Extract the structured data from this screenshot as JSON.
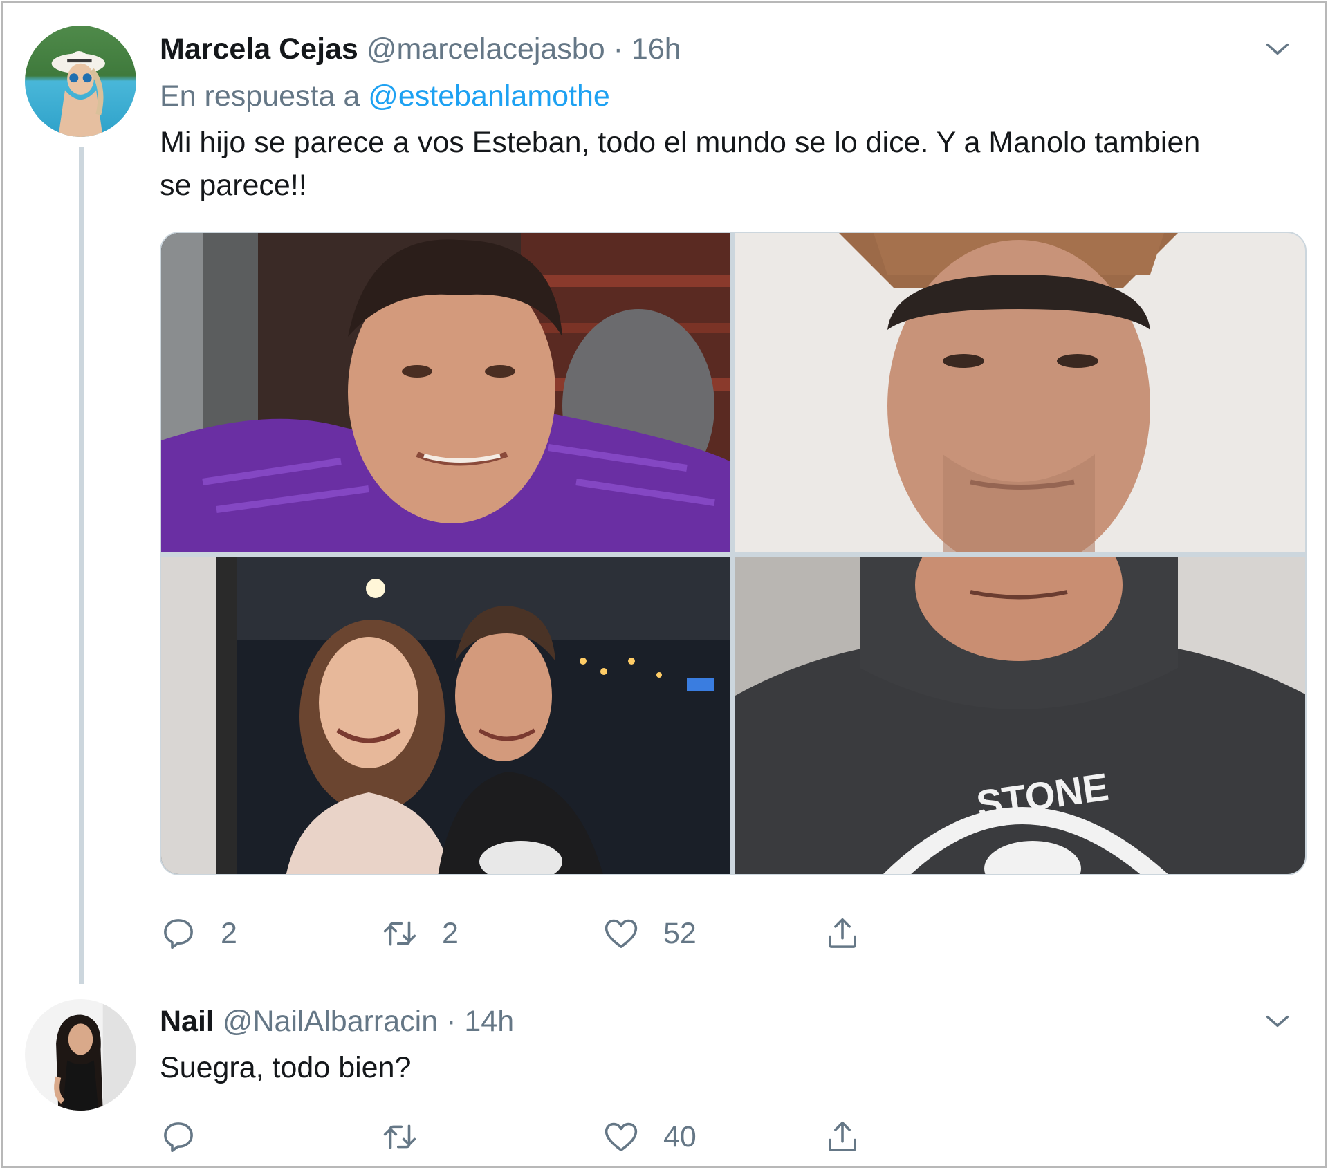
{
  "tweets": [
    {
      "display_name": "Marcela Cejas",
      "handle": "@marcelacejasbo",
      "separator": "·",
      "time": "16h",
      "reply_prefix": "En respuesta a",
      "reply_handle": "@estebanlamothe",
      "text": "Mi hijo se parece a vos Esteban, todo el mundo se lo dice. Y a Manolo tambien se parece!!",
      "media_overlay_text": "STONE",
      "actions": {
        "replies": "2",
        "retweets": "2",
        "likes": "52"
      }
    },
    {
      "display_name": "Nail",
      "handle": "@NailAlbarracin",
      "separator": "·",
      "time": "14h",
      "text": "Suegra, todo bien?",
      "actions": {
        "replies": "",
        "retweets": "",
        "likes": "40"
      }
    }
  ],
  "icons": {
    "caret": "chevron-down-icon",
    "reply": "reply-icon",
    "retweet": "retweet-icon",
    "like": "heart-icon",
    "share": "share-icon"
  },
  "colors": {
    "link": "#1da1f2",
    "secondary_text": "#657786",
    "thread_line": "#ccd6dd",
    "primary_text": "#14171a"
  }
}
